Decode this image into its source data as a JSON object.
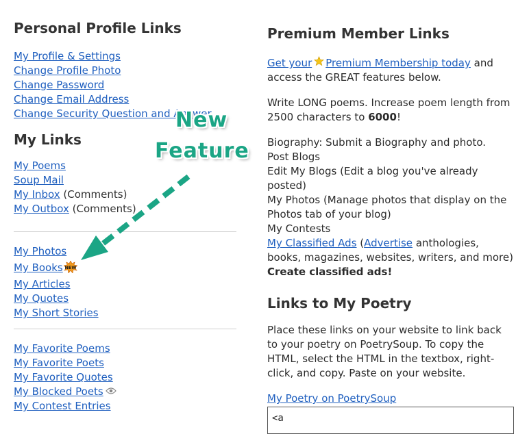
{
  "personal": {
    "heading": "Personal Profile Links",
    "links": [
      "My Profile & Settings",
      "Change Profile Photo",
      "Change Password",
      "Change Email Address",
      "Change Security Question and Answer"
    ]
  },
  "mylinks": {
    "heading": "My Links",
    "group1": [
      {
        "label": "My Poems",
        "suffix": ""
      },
      {
        "label": "Soup Mail",
        "suffix": ""
      },
      {
        "label": "My Inbox",
        "suffix": " (Comments)"
      },
      {
        "label": "My Outbox",
        "suffix": " (Comments)"
      }
    ],
    "group2": [
      "My Photos",
      "My Books",
      "My Articles",
      "My Quotes",
      "My Short Stories"
    ],
    "group3": [
      "My Favorite Poems",
      "My Favorite Poets",
      "My Favorite Quotes",
      "My Blocked Poets",
      "My Contest Entries"
    ],
    "new_badge": "NEW"
  },
  "overlay": {
    "line1": "New",
    "line2": "Feature",
    "color": "#1ba585"
  },
  "premium": {
    "heading": "Premium Member Links",
    "get_your": "Get your",
    "membership_link": "Premium Membership today",
    "after_link": " and access the GREAT features below.",
    "write_long_pre": "Write LONG poems. Increase poem length from 2500 characters to ",
    "write_long_bold": "6000",
    "write_long_post": "!",
    "features": [
      "Biography: Submit a Biography and photo.",
      "Post Blogs",
      "Edit My Blogs (Edit a blog you've already posted)",
      "My Photos (Manage photos that display on the Photos tab of your blog)",
      "My Contests"
    ],
    "classified_link": "My Classified Ads",
    "open_paren": " (",
    "advertise_link": "Advertise",
    "classified_rest": " anthologies, books, magazines, websites, writers, and more) ",
    "classified_bold": "Create classified ads!"
  },
  "poetry_links": {
    "heading": "Links to My Poetry",
    "description": "Place these links on your website to link back to your poetry on PoetrySoup. To copy the HTML, select the HTML in the textbox, right-click, and copy. Paste on your website.",
    "link": "My Poetry on PoetrySoup",
    "code_preview": "<a"
  }
}
